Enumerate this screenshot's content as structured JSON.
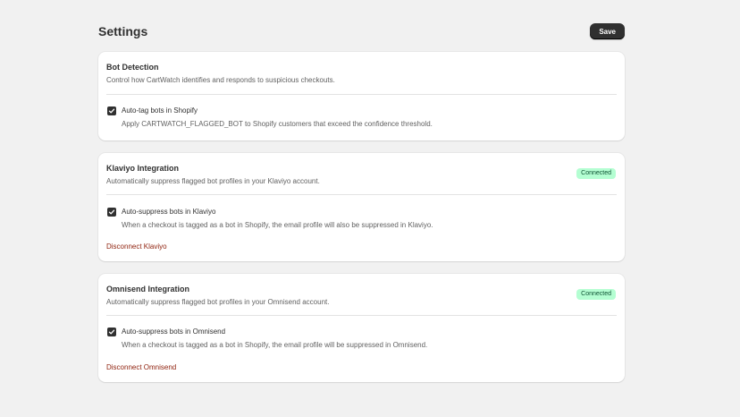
{
  "header": {
    "title": "Settings",
    "save_label": "Save"
  },
  "bot_detection": {
    "title": "Bot Detection",
    "description": "Control how CartWatch identifies and responds to suspicious checkouts.",
    "checkbox": {
      "label": "Auto-tag bots in Shopify",
      "help": "Apply CARTWATCH_FLAGGED_BOT to Shopify customers that exceed the confidence threshold.",
      "checked": true
    }
  },
  "klaviyo": {
    "title": "Klaviyo Integration",
    "description": "Automatically suppress flagged bot profiles in your Klaviyo account.",
    "status": "Connected",
    "checkbox": {
      "label": "Auto-suppress bots in Klaviyo",
      "help": "When a checkout is tagged as a bot in Shopify, the email profile will also be suppressed in Klaviyo.",
      "checked": true
    },
    "disconnect_label": "Disconnect Klaviyo"
  },
  "omnisend": {
    "title": "Omnisend Integration",
    "description": "Automatically suppress flagged bot profiles in your Omnisend account.",
    "status": "Connected",
    "checkbox": {
      "label": "Auto-suppress bots in Omnisend",
      "help": "When a checkout is tagged as a bot in Shopify, the email profile will be suppressed in Omnisend.",
      "checked": true
    },
    "disconnect_label": "Disconnect Omnisend"
  },
  "colors": {
    "primary_button": "#303030",
    "badge_bg": "#b4fed2",
    "badge_text": "#0c5132",
    "critical_link": "#8e1f0b",
    "page_bg": "#f1f1f1"
  },
  "icons": {
    "checkbox_check": "checkmark-icon"
  }
}
